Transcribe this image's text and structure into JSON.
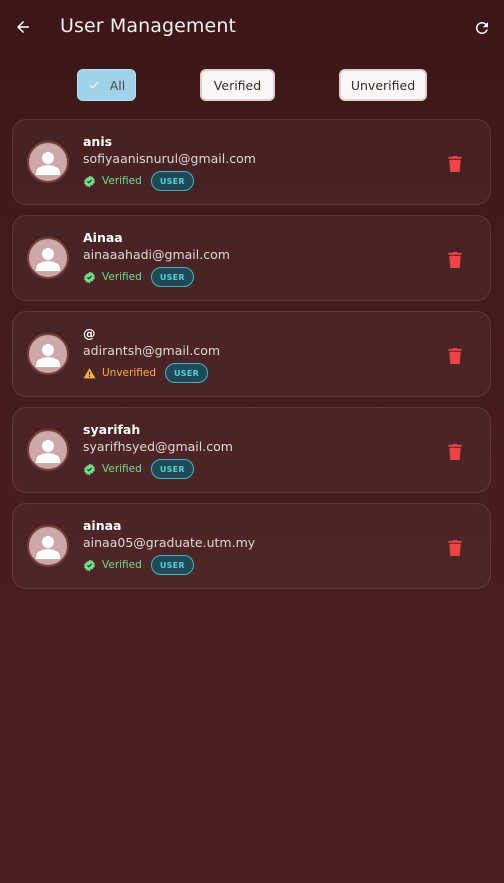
{
  "header": {
    "title": "User Management",
    "back_icon": "arrow-left-icon",
    "refresh_icon": "refresh-icon"
  },
  "filters": {
    "all": "All",
    "verified": "Verified",
    "unverified": "Unverified",
    "selected": "All"
  },
  "colors": {
    "background": "#3d1718",
    "chip_selected": "#9fd3ea",
    "verified": "#6fdc8c",
    "unverified": "#f5b041",
    "role_badge": "#54d0e0",
    "delete": "#ef4444"
  },
  "users": [
    {
      "name": "anis",
      "email": "sofiyaanisnurul@gmail.com",
      "status": "Verified",
      "role": "USER"
    },
    {
      "name": "Ainaa",
      "email": "ainaaahadi@gmail.com",
      "status": "Verified",
      "role": "USER"
    },
    {
      "name": "@",
      "email": "adirantsh@gmail.com",
      "status": "Unverified",
      "role": "USER"
    },
    {
      "name": "syarifah",
      "email": "syarifhsyed@gmail.com",
      "status": "Verified",
      "role": "USER"
    },
    {
      "name": "ainaa",
      "email": "ainaa05@graduate.utm.my",
      "status": "Verified",
      "role": "USER"
    }
  ]
}
